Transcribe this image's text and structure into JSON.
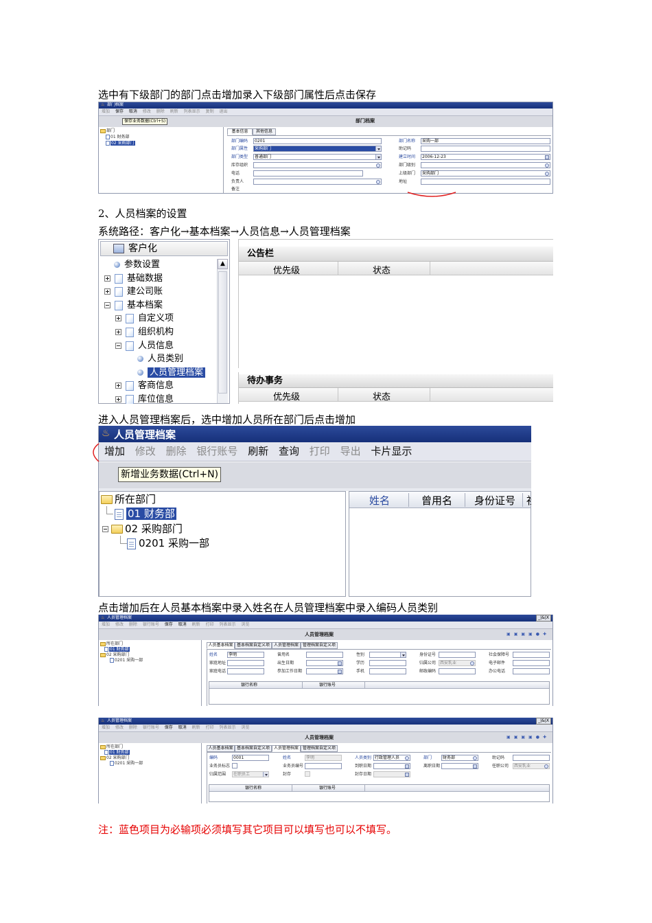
{
  "doc": {
    "p1": "选中有下级部门的部门点击增加录入下级部门属性后点击保存",
    "p2": "2、人员档案的设置",
    "p3": "系统路径：客户化→基本档案→人员信息→人员管理档案",
    "p4": "进入人员管理档案后，选中增加人员所在部门后点击增加",
    "p5": "点击增加后在人员基本档案中录入姓名在人员管理档案中录入编码人员类别",
    "note": "注：蓝色项目为必输项必须填写其它项目可以填写也可以不填写。"
  },
  "colors": {
    "note": "#e60000",
    "accent": "#2a4ca4",
    "titlebar": "#1e3a8a"
  },
  "shot1": {
    "window_title": "部门档案",
    "toolbar": [
      "增加",
      "保存",
      "取消",
      "修改",
      "删除",
      "刷新",
      "列表显示",
      "复制",
      "退出"
    ],
    "toolbar_active": [
      false,
      true,
      true,
      false,
      false,
      false,
      false,
      false,
      false
    ],
    "tooltip": "保存业务数据(Ctrl+S)",
    "heading": "部门档案",
    "tree": {
      "root": "部门",
      "items": [
        "01 财务部",
        "02 采购部门"
      ]
    },
    "tabs": [
      "基本信息",
      "其他信息"
    ],
    "left_labels": [
      "部门编码",
      "部门属性",
      "部门类型",
      "库存组织",
      "电话",
      "负责人",
      "备注"
    ],
    "left_values": [
      "0201",
      "采购部门",
      "普通部门",
      "",
      "",
      "",
      ""
    ],
    "right_labels": [
      "部门名称",
      "助记码",
      "建立时间",
      "部门级别",
      "上级部门",
      "地址"
    ],
    "right_values": [
      "采购一部",
      "",
      "2006-12-23",
      "",
      "采购部门",
      ""
    ]
  },
  "shot2": {
    "tree_title": "客户化",
    "tree": [
      "参数设置",
      "基础数据",
      "建公司账",
      "基本档案",
      "自定义项",
      "组织机构",
      "人员信息",
      "人员类别",
      "人员管理档案",
      "客商信息",
      "库位信息"
    ],
    "bulletin": {
      "title": "公告栏",
      "col1": "优先级",
      "col2": "状态"
    },
    "todo": {
      "title": "待办事务",
      "col1": "优先级",
      "col2": "状态"
    }
  },
  "shot3": {
    "window_title": "人员管理档案",
    "toolbar": [
      "增加",
      "修改",
      "删除",
      "银行账号",
      "刷新",
      "查询",
      "打印",
      "导出",
      "卡片显示"
    ],
    "toolbar_active": [
      true,
      false,
      false,
      false,
      true,
      true,
      false,
      false,
      true
    ],
    "tooltip": "新增业务数据(Ctrl+N)",
    "tree": {
      "root": "所在部门",
      "items": [
        "01 财务部",
        "02 采购部门",
        "0201 采购一部"
      ]
    },
    "columns": [
      "姓名",
      "曾用名",
      "身份证号",
      "社"
    ]
  },
  "shot4": {
    "window_title": "人员管理档案",
    "toolbar": [
      "增加",
      "修改",
      "删除",
      "银行账号",
      "保存",
      "取消",
      "刷新",
      "打印",
      "列表显示",
      "浏览"
    ],
    "toolbar_active": [
      false,
      false,
      false,
      false,
      true,
      true,
      false,
      false,
      false,
      false
    ],
    "win_buttons": "_|&|X",
    "heading": "人员管理档案",
    "tree": {
      "root": "所在部门",
      "items": [
        "01 财务部",
        "02 采购部门",
        "0201 采购一部"
      ]
    },
    "tabs": [
      "人员基本档案",
      "基本档案自定义项",
      "人员管理档案",
      "管理档案自定义项"
    ],
    "row1_labels": [
      "姓名",
      "曾用名",
      "性别",
      "身份证号",
      "社会保障号"
    ],
    "name_value": "李明",
    "row2_labels": [
      "家庭地址",
      "出生日期",
      "学历",
      "归属公司",
      "电子邮件"
    ],
    "company_value": "西安乳业",
    "row3_labels": [
      "家庭电话",
      "参加工作日期",
      "手机",
      "邮政编码",
      "办公电话"
    ],
    "grid_cols": [
      "银行名称",
      "银行账号"
    ]
  },
  "shot5": {
    "window_title": "人员管理档案",
    "toolbar": [
      "增加",
      "修改",
      "删除",
      "银行账号",
      "保存",
      "取消",
      "刷新",
      "打印",
      "列表显示",
      "浏览"
    ],
    "toolbar_active": [
      false,
      false,
      false,
      false,
      true,
      true,
      false,
      false,
      false,
      false
    ],
    "win_buttons": "_|&|X",
    "heading": "人员管理档案",
    "tree": {
      "root": "所在部门",
      "items": [
        "01 财务部",
        "02 采购部门",
        "0201 采购一部"
      ]
    },
    "tabs": [
      "人员基本档案",
      "基本档案自定义项",
      "人员管理档案",
      "管理档案自定义项"
    ],
    "row1_labels": [
      "编码",
      "姓名",
      "人员类别",
      "部门",
      "助记码"
    ],
    "row1_values": [
      "0001",
      "李明",
      "行政管理人员",
      "财务部",
      ""
    ],
    "row2_labels": [
      "业务员标志",
      "业务员编号",
      "到职日期",
      "离职日期",
      "任职公司"
    ],
    "company_value": "西安乳业",
    "row3_labels": [
      "归属范围",
      "封存",
      "封存日期"
    ],
    "scope_value": "在职员工",
    "grid_cols": [
      "银行名称",
      "银行账号"
    ]
  }
}
